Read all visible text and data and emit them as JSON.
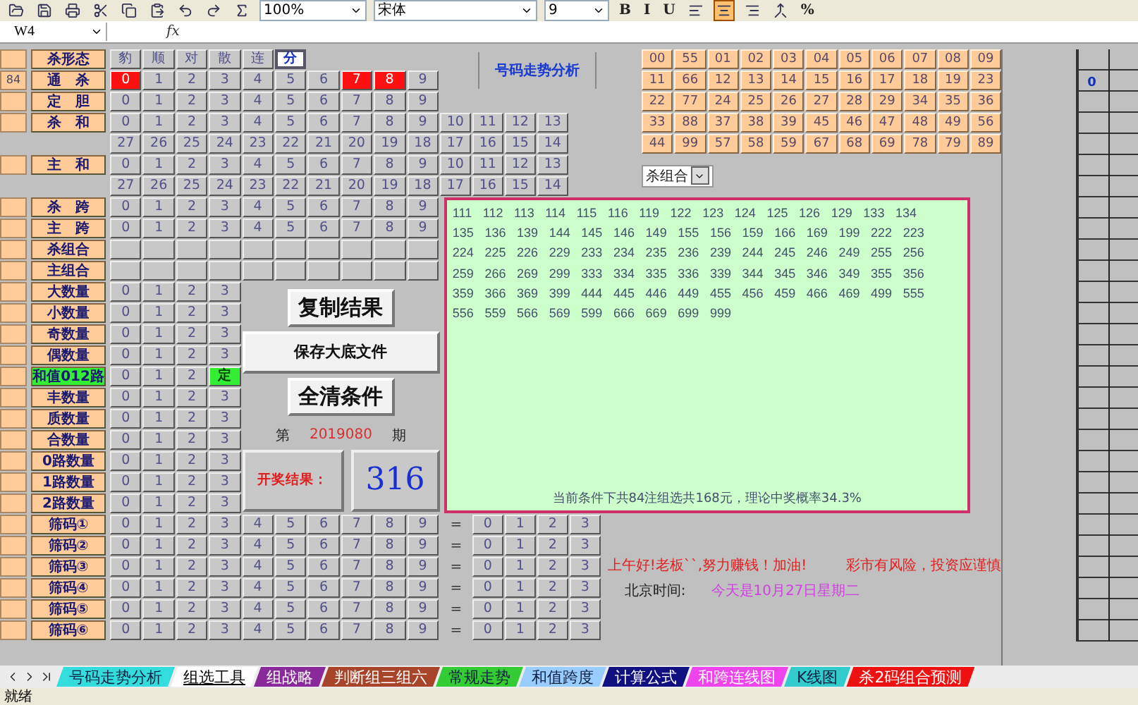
{
  "toolbar": {
    "zoom": "100%",
    "font": "宋体",
    "size": "9",
    "format_buttons": [
      "B",
      "I",
      "U"
    ],
    "alignment": [
      {
        "kind": "left",
        "selected": false
      },
      {
        "kind": "center",
        "selected": true
      },
      {
        "kind": "right",
        "selected": false
      },
      {
        "kind": "merge",
        "selected": false
      }
    ],
    "number_format": "%"
  },
  "formula_bar": {
    "name_box": "W4",
    "fx_label": "fx"
  },
  "rows": [
    {
      "label": "杀形态",
      "label_active": false,
      "col_a_filled": true,
      "kind": "pattern",
      "cells": [
        {
          "text": "豹",
          "selected": false
        },
        {
          "text": "顺",
          "selected": false
        },
        {
          "text": "对",
          "selected": false
        },
        {
          "text": "散",
          "selected": false
        },
        {
          "text": "连",
          "selected": false
        },
        {
          "text": "分",
          "selected": true
        }
      ]
    },
    {
      "label": "通　杀",
      "label_active": false,
      "col_a_filled": true,
      "col_a_text": "84",
      "kind": "digits",
      "cells": [
        {
          "text": "0",
          "selected": true
        },
        {
          "text": "1",
          "selected": false
        },
        {
          "text": "2",
          "selected": false
        },
        {
          "text": "3",
          "selected": false
        },
        {
          "text": "4",
          "selected": false
        },
        {
          "text": "5",
          "selected": false
        },
        {
          "text": "6",
          "selected": false
        },
        {
          "text": "7",
          "selected": true
        },
        {
          "text": "8",
          "selected": true
        },
        {
          "text": "9",
          "selected": false
        }
      ]
    },
    {
      "label": "定　胆",
      "label_active": false,
      "col_a_filled": true,
      "kind": "digits",
      "cells": [
        {
          "text": "0",
          "selected": false
        },
        {
          "text": "1",
          "selected": false
        },
        {
          "text": "2",
          "selected": false
        },
        {
          "text": "3",
          "selected": false
        },
        {
          "text": "4",
          "selected": false
        },
        {
          "text": "5",
          "selected": false
        },
        {
          "text": "6",
          "selected": false
        },
        {
          "text": "7",
          "selected": false
        },
        {
          "text": "8",
          "selected": false
        },
        {
          "text": "9",
          "selected": false
        }
      ]
    },
    {
      "label": "杀　和",
      "label_active": false,
      "col_a_filled": true,
      "kind": "digits",
      "cells": [
        {
          "text": "0",
          "selected": false
        },
        {
          "text": "1",
          "selected": false
        },
        {
          "text": "2",
          "selected": false
        },
        {
          "text": "3",
          "selected": false
        },
        {
          "text": "4",
          "selected": false
        },
        {
          "text": "5",
          "selected": false
        },
        {
          "text": "6",
          "selected": false
        },
        {
          "text": "7",
          "selected": false
        },
        {
          "text": "8",
          "selected": false
        },
        {
          "text": "9",
          "selected": false
        },
        {
          "text": "10",
          "selected": false
        },
        {
          "text": "11",
          "selected": false
        },
        {
          "text": "12",
          "selected": false
        },
        {
          "text": "13",
          "selected": false
        }
      ]
    },
    {
      "kind": "digits",
      "cells": [
        {
          "text": "27",
          "selected": false
        },
        {
          "text": "26",
          "selected": false
        },
        {
          "text": "25",
          "selected": false
        },
        {
          "text": "24",
          "selected": false
        },
        {
          "text": "23",
          "selected": false
        },
        {
          "text": "22",
          "selected": false
        },
        {
          "text": "21",
          "selected": false
        },
        {
          "text": "20",
          "selected": false
        },
        {
          "text": "19",
          "selected": false
        },
        {
          "text": "18",
          "selected": false
        },
        {
          "text": "17",
          "selected": false
        },
        {
          "text": "16",
          "selected": false
        },
        {
          "text": "15",
          "selected": false
        },
        {
          "text": "14",
          "selected": false
        }
      ]
    },
    {
      "label": "主　和",
      "label_active": false,
      "col_a_filled": true,
      "kind": "digits",
      "cells": [
        {
          "text": "0",
          "selected": false
        },
        {
          "text": "1",
          "selected": false
        },
        {
          "text": "2",
          "selected": false
        },
        {
          "text": "3",
          "selected": false
        },
        {
          "text": "4",
          "selected": false
        },
        {
          "text": "5",
          "selected": false
        },
        {
          "text": "6",
          "selected": false
        },
        {
          "text": "7",
          "selected": false
        },
        {
          "text": "8",
          "selected": false
        },
        {
          "text": "9",
          "selected": false
        },
        {
          "text": "10",
          "selected": false
        },
        {
          "text": "11",
          "selected": false
        },
        {
          "text": "12",
          "selected": false
        },
        {
          "text": "13",
          "selected": false
        }
      ]
    },
    {
      "kind": "digits",
      "cells": [
        {
          "text": "27",
          "selected": false
        },
        {
          "text": "26",
          "selected": false
        },
        {
          "text": "25",
          "selected": false
        },
        {
          "text": "24",
          "selected": false
        },
        {
          "text": "23",
          "selected": false
        },
        {
          "text": "22",
          "selected": false
        },
        {
          "text": "21",
          "selected": false
        },
        {
          "text": "20",
          "selected": false
        },
        {
          "text": "19",
          "selected": false
        },
        {
          "text": "18",
          "selected": false
        },
        {
          "text": "17",
          "selected": false
        },
        {
          "text": "16",
          "selected": false
        },
        {
          "text": "15",
          "selected": false
        },
        {
          "text": "14",
          "selected": false
        }
      ]
    },
    {
      "label": "杀　跨",
      "label_active": false,
      "col_a_filled": true,
      "kind": "digits",
      "cells": [
        {
          "text": "0",
          "selected": false
        },
        {
          "text": "1",
          "selected": false
        },
        {
          "text": "2",
          "selected": false
        },
        {
          "text": "3",
          "selected": false
        },
        {
          "text": "4",
          "selected": false
        },
        {
          "text": "5",
          "selected": false
        },
        {
          "text": "6",
          "selected": false
        },
        {
          "text": "7",
          "selected": false
        },
        {
          "text": "8",
          "selected": false
        },
        {
          "text": "9",
          "selected": false
        }
      ]
    },
    {
      "label": "主　跨",
      "label_active": false,
      "col_a_filled": true,
      "kind": "digits",
      "cells": [
        {
          "text": "0",
          "selected": false
        },
        {
          "text": "1",
          "selected": false
        },
        {
          "text": "2",
          "selected": false
        },
        {
          "text": "3",
          "selected": false
        },
        {
          "text": "4",
          "selected": false
        },
        {
          "text": "5",
          "selected": false
        },
        {
          "text": "6",
          "selected": false
        },
        {
          "text": "7",
          "selected": false
        },
        {
          "text": "8",
          "selected": false
        },
        {
          "text": "9",
          "selected": false
        }
      ]
    },
    {
      "label": "杀组合",
      "label_active": false,
      "col_a_filled": true,
      "kind": "digits",
      "cells": [
        {
          "selected": false
        },
        {
          "selected": false
        },
        {
          "selected": false
        },
        {
          "selected": false
        },
        {
          "selected": false
        },
        {
          "selected": false
        },
        {
          "selected": false
        },
        {
          "selected": false
        },
        {
          "selected": false
        },
        {
          "selected": false
        }
      ]
    },
    {
      "label": "主组合",
      "label_active": false,
      "col_a_filled": true,
      "kind": "digits",
      "cells": [
        {
          "selected": false
        },
        {
          "selected": false
        },
        {
          "selected": false
        },
        {
          "selected": false
        },
        {
          "selected": false
        },
        {
          "selected": false
        },
        {
          "selected": false
        },
        {
          "selected": false
        },
        {
          "selected": false
        },
        {
          "selected": false
        }
      ]
    },
    {
      "label": "大数量",
      "label_active": false,
      "col_a_filled": true,
      "kind": "counts",
      "cells": [
        {
          "text": "0",
          "selected": false
        },
        {
          "text": "1",
          "selected": false
        },
        {
          "text": "2",
          "selected": false
        },
        {
          "text": "3",
          "selected": false
        }
      ]
    },
    {
      "label": "小数量",
      "label_active": false,
      "col_a_filled": true,
      "kind": "counts",
      "cells": [
        {
          "text": "0",
          "selected": false
        },
        {
          "text": "1",
          "selected": false
        },
        {
          "text": "2",
          "selected": false
        },
        {
          "text": "3",
          "selected": false
        }
      ]
    },
    {
      "label": "奇数量",
      "label_active": false,
      "col_a_filled": true,
      "kind": "counts",
      "cells": [
        {
          "text": "0",
          "selected": false
        },
        {
          "text": "1",
          "selected": false
        },
        {
          "text": "2",
          "selected": false
        },
        {
          "text": "3",
          "selected": false
        }
      ]
    },
    {
      "label": "偶数量",
      "label_active": false,
      "col_a_filled": true,
      "kind": "counts",
      "cells": [
        {
          "text": "0",
          "selected": false
        },
        {
          "text": "1",
          "selected": false
        },
        {
          "text": "2",
          "selected": false
        },
        {
          "text": "3",
          "selected": false
        }
      ]
    },
    {
      "label": "和值012路",
      "label_active": true,
      "col_a_filled": true,
      "kind": "counts",
      "cells": [
        {
          "text": "0",
          "selected": false
        },
        {
          "text": "1",
          "selected": false
        },
        {
          "text": "2",
          "selected": false
        },
        {
          "text": "定",
          "selected": true
        }
      ]
    },
    {
      "label": "丰数量",
      "label_active": false,
      "col_a_filled": true,
      "kind": "counts",
      "cells": [
        {
          "text": "0",
          "selected": false
        },
        {
          "text": "1",
          "selected": false
        },
        {
          "text": "2",
          "selected": false
        },
        {
          "text": "3",
          "selected": false
        }
      ]
    },
    {
      "label": "质数量",
      "label_active": false,
      "col_a_filled": true,
      "kind": "counts",
      "cells": [
        {
          "text": "0",
          "selected": false
        },
        {
          "text": "1",
          "selected": false
        },
        {
          "text": "2",
          "selected": false
        },
        {
          "text": "3",
          "selected": false
        }
      ]
    },
    {
      "label": "合数量",
      "label_active": false,
      "col_a_filled": true,
      "kind": "counts",
      "cells": [
        {
          "text": "0",
          "selected": false
        },
        {
          "text": "1",
          "selected": false
        },
        {
          "text": "2",
          "selected": false
        },
        {
          "text": "3",
          "selected": false
        }
      ]
    },
    {
      "label": "0路数量",
      "label_active": false,
      "col_a_filled": true,
      "kind": "counts",
      "cells": [
        {
          "text": "0",
          "selected": false
        },
        {
          "text": "1",
          "selected": false
        },
        {
          "text": "2",
          "selected": false
        },
        {
          "text": "3",
          "selected": false
        }
      ]
    },
    {
      "label": "1路数量",
      "label_active": false,
      "col_a_filled": true,
      "kind": "counts",
      "cells": [
        {
          "text": "0",
          "selected": false
        },
        {
          "text": "1",
          "selected": false
        },
        {
          "text": "2",
          "selected": false
        },
        {
          "text": "3",
          "selected": false
        }
      ]
    },
    {
      "label": "2路数量",
      "label_active": false,
      "col_a_filled": true,
      "kind": "counts",
      "cells": [
        {
          "text": "0",
          "selected": false
        },
        {
          "text": "1",
          "selected": false
        },
        {
          "text": "2",
          "selected": false
        },
        {
          "text": "3",
          "selected": false
        }
      ]
    },
    {
      "label": "筛码①",
      "label_active": false,
      "col_a_filled": true,
      "kind": "sieve",
      "cells": [
        {
          "text": "0",
          "selected": false
        },
        {
          "text": "1",
          "selected": false
        },
        {
          "text": "2",
          "selected": false
        },
        {
          "text": "3",
          "selected": false
        },
        {
          "text": "4",
          "selected": false
        },
        {
          "text": "5",
          "selected": false
        },
        {
          "text": "6",
          "selected": false
        },
        {
          "text": "7",
          "selected": false
        },
        {
          "text": "8",
          "selected": false
        },
        {
          "text": "9",
          "selected": false
        }
      ],
      "equals": "=",
      "result_cells": [
        {
          "text": "0",
          "selected": false
        },
        {
          "text": "1",
          "selected": false
        },
        {
          "text": "2",
          "selected": false
        },
        {
          "text": "3",
          "selected": false
        }
      ]
    },
    {
      "label": "筛码②",
      "label_active": false,
      "col_a_filled": true,
      "kind": "sieve",
      "cells": [
        {
          "text": "0",
          "selected": false
        },
        {
          "text": "1",
          "selected": false
        },
        {
          "text": "2",
          "selected": false
        },
        {
          "text": "3",
          "selected": false
        },
        {
          "text": "4",
          "selected": false
        },
        {
          "text": "5",
          "selected": false
        },
        {
          "text": "6",
          "selected": false
        },
        {
          "text": "7",
          "selected": false
        },
        {
          "text": "8",
          "selected": false
        },
        {
          "text": "9",
          "selected": false
        }
      ],
      "equals": "=",
      "result_cells": [
        {
          "text": "0",
          "selected": false
        },
        {
          "text": "1",
          "selected": false
        },
        {
          "text": "2",
          "selected": false
        },
        {
          "text": "3",
          "selected": false
        }
      ]
    },
    {
      "label": "筛码③",
      "label_active": false,
      "col_a_filled": true,
      "kind": "sieve",
      "cells": [
        {
          "text": "0",
          "selected": false
        },
        {
          "text": "1",
          "selected": false
        },
        {
          "text": "2",
          "selected": false
        },
        {
          "text": "3",
          "selected": false
        },
        {
          "text": "4",
          "selected": false
        },
        {
          "text": "5",
          "selected": false
        },
        {
          "text": "6",
          "selected": false
        },
        {
          "text": "7",
          "selected": false
        },
        {
          "text": "8",
          "selected": false
        },
        {
          "text": "9",
          "selected": false
        }
      ],
      "equals": "=",
      "result_cells": [
        {
          "text": "0",
          "selected": false
        },
        {
          "text": "1",
          "selected": false
        },
        {
          "text": "2",
          "selected": false
        },
        {
          "text": "3",
          "selected": false
        }
      ]
    },
    {
      "label": "筛码④",
      "label_active": false,
      "col_a_filled": true,
      "kind": "sieve",
      "cells": [
        {
          "text": "0",
          "selected": false
        },
        {
          "text": "1",
          "selected": false
        },
        {
          "text": "2",
          "selected": false
        },
        {
          "text": "3",
          "selected": false
        },
        {
          "text": "4",
          "selected": false
        },
        {
          "text": "5",
          "selected": false
        },
        {
          "text": "6",
          "selected": false
        },
        {
          "text": "7",
          "selected": false
        },
        {
          "text": "8",
          "selected": false
        },
        {
          "text": "9",
          "selected": false
        }
      ],
      "equals": "=",
      "result_cells": [
        {
          "text": "0",
          "selected": false
        },
        {
          "text": "1",
          "selected": false
        },
        {
          "text": "2",
          "selected": false
        },
        {
          "text": "3",
          "selected": false
        }
      ]
    },
    {
      "label": "筛码⑤",
      "label_active": false,
      "col_a_filled": true,
      "kind": "sieve",
      "cells": [
        {
          "text": "0",
          "selected": false
        },
        {
          "text": "1",
          "selected": false
        },
        {
          "text": "2",
          "selected": false
        },
        {
          "text": "3",
          "selected": false
        },
        {
          "text": "4",
          "selected": false
        },
        {
          "text": "5",
          "selected": false
        },
        {
          "text": "6",
          "selected": false
        },
        {
          "text": "7",
          "selected": false
        },
        {
          "text": "8",
          "selected": false
        },
        {
          "text": "9",
          "selected": false
        }
      ],
      "equals": "=",
      "result_cells": [
        {
          "text": "0",
          "selected": false
        },
        {
          "text": "1",
          "selected": false
        },
        {
          "text": "2",
          "selected": false
        },
        {
          "text": "3",
          "selected": false
        }
      ]
    },
    {
      "label": "筛码⑥",
      "label_active": false,
      "col_a_filled": true,
      "kind": "sieve",
      "cells": [
        {
          "text": "0",
          "selected": false
        },
        {
          "text": "1",
          "selected": false
        },
        {
          "text": "2",
          "selected": false
        },
        {
          "text": "3",
          "selected": false
        },
        {
          "text": "4",
          "selected": false
        },
        {
          "text": "5",
          "selected": false
        },
        {
          "text": "6",
          "selected": false
        },
        {
          "text": "7",
          "selected": false
        },
        {
          "text": "8",
          "selected": false
        },
        {
          "text": "9",
          "selected": false
        }
      ],
      "equals": "=",
      "result_cells": [
        {
          "text": "0",
          "selected": false
        },
        {
          "text": "1",
          "selected": false
        },
        {
          "text": "2",
          "selected": false
        },
        {
          "text": "3",
          "selected": false
        }
      ]
    }
  ],
  "title_box": "号码走势分析",
  "number_grid": [
    [
      "00",
      "55",
      "01",
      "02",
      "03",
      "04",
      "05",
      "06",
      "07",
      "08",
      "09"
    ],
    [
      "11",
      "66",
      "12",
      "13",
      "14",
      "15",
      "16",
      "17",
      "18",
      "19",
      "23"
    ],
    [
      "22",
      "77",
      "24",
      "25",
      "26",
      "27",
      "28",
      "29",
      "34",
      "35",
      "36"
    ],
    [
      "33",
      "88",
      "37",
      "38",
      "39",
      "45",
      "46",
      "47",
      "48",
      "49",
      "56"
    ],
    [
      "44",
      "99",
      "57",
      "58",
      "59",
      "67",
      "68",
      "69",
      "78",
      "79",
      "89"
    ]
  ],
  "dropdown": "杀组合",
  "side_value": "0",
  "results": {
    "lines": [
      "111 112 113 114 115 116 119 122 123 124 125 126 129 133 134",
      "135 136 139 144 145 146 149 155 156 159 166 169 199 222 223",
      "224 225 226 229 233 234 235 236 239 244 245 246 249 255 256",
      "259 266 269 299 333 334 335 336 339 344 345 346 349 355 356",
      "359 366 369 399 444 445 446 449 455 456 459 466 469 499 555",
      "556 559 566 569 599 666 669 699 999"
    ],
    "summary": "当前条件下共84注组选共168元，理论中奖概率34.3%"
  },
  "controls": {
    "copy": "复制结果",
    "save": "保存大底文件",
    "clear": "全清条件",
    "issue_prefix": "第",
    "issue": "2019080",
    "issue_suffix": "期",
    "draw_label": "开奖结果：",
    "draw_value": "316"
  },
  "messages": {
    "greeting": "上午好!老板``,努力赚钱！加油!",
    "warning": "彩市有风险，投资应谨慎",
    "time_label": "北京时间:",
    "date": "今天是10月27日星期二"
  },
  "tabs": [
    {
      "label": "号码走势分析",
      "selected": false,
      "color": "#33dddd"
    },
    {
      "label": "组选工具",
      "selected": true,
      "color": "#ffffff"
    },
    {
      "label": "组战略",
      "selected": false,
      "color": "#8a2a9a"
    },
    {
      "label": "判断组三组六",
      "selected": false,
      "color": "#a8442a"
    },
    {
      "label": "常规走势",
      "selected": false,
      "color": "#33cc33"
    },
    {
      "label": "和值跨度",
      "selected": false,
      "color": "#99ccff"
    },
    {
      "label": "计算公式",
      "selected": false,
      "color": "#101080"
    },
    {
      "label": "和跨连线图",
      "selected": false,
      "color": "#ee44ee"
    },
    {
      "label": "K线图",
      "selected": false,
      "color": "#33cccc"
    },
    {
      "label": "杀2码组合预测",
      "selected": false,
      "color": "#ee1111"
    }
  ],
  "status_bar": "就绪"
}
